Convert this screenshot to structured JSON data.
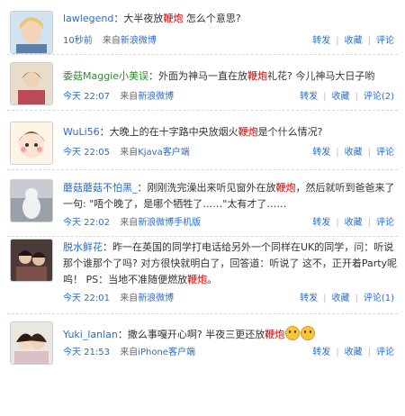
{
  "comments": [
    {
      "user": "lawlegend",
      "user_color": "#2a6cc0",
      "pre": "：大半夜放",
      "hl": "鞭炮",
      "post": " 怎么个意思?",
      "time": "10秒前",
      "source_prefix": "来自",
      "source": "新浪微博",
      "repost": "转发",
      "fav": "收藏",
      "comment": "评论"
    },
    {
      "user": "委菇Maggie小美误",
      "user_color": "#2e8b2e",
      "pre": "：外面为神马一直在放",
      "hl": "鞭炮",
      "post": "礼花? 今儿神马大日子哟",
      "time": "今天 22:07",
      "source_prefix": "来自",
      "source": "新浪微博",
      "repost": "转发",
      "fav": "收藏",
      "comment": "评论(2)"
    },
    {
      "user": "WuLi56",
      "user_color": "#2a6cc0",
      "pre": "：大晚上的在十字路中央放烟火",
      "hl": "鞭炮",
      "post": "是个什么情况?",
      "time": "今天 22:05",
      "source_prefix": "来自",
      "source": "Kjava客户端",
      "repost": "转发",
      "fav": "收藏",
      "comment": "评论"
    },
    {
      "user": "蘑菇蘑菇不怕黑_",
      "user_color": "#2a6cc0",
      "pre": "：刚刚洗完澡出来听见窗外在放",
      "hl": "鞭炮",
      "post": "，然后就听到爸爸来了一句: \"唔个晚了，是哪个牺牲了……\"太有才了……",
      "time": "今天 22:02",
      "source_prefix": "来自",
      "source": "新浪微博手机版",
      "repost": "转发",
      "fav": "收藏",
      "comment": "评论"
    },
    {
      "user": "脱水鲜花",
      "user_color": "#2a6cc0",
      "pre": "：昨一在英国的同学打电话给另外一个同样在UK的同学，问：听说那个谁那个了吗? 对方很快就明白了，回答道：听说了 这不，正开着Party呢 呜！ PS：当地不准随便燃放",
      "hl": "鞭炮",
      "post": "。",
      "time": "今天 22:01",
      "source_prefix": "来自",
      "source": "新浪微博",
      "repost": "转发",
      "fav": "收藏",
      "comment": "评论(1)"
    },
    {
      "user": "Yuki_lanlan",
      "user_color": "#2a6cc0",
      "pre": "：撒么事嘎开心啊? 半夜三更还放",
      "hl": "鞭炮",
      "post": "",
      "time": "今天 21:53",
      "source_prefix": "来自",
      "source": "iPhone客户端",
      "repost": "转发",
      "fav": "收藏",
      "comment": "评论"
    }
  ],
  "colors": {
    "link": "#2a6cc0",
    "highlight": "#cc0000",
    "separator": "#d8d8d8"
  },
  "icons": [
    "avatar-1",
    "avatar-2",
    "avatar-3",
    "avatar-4",
    "avatar-5",
    "avatar-6",
    "emoji-icon"
  ]
}
